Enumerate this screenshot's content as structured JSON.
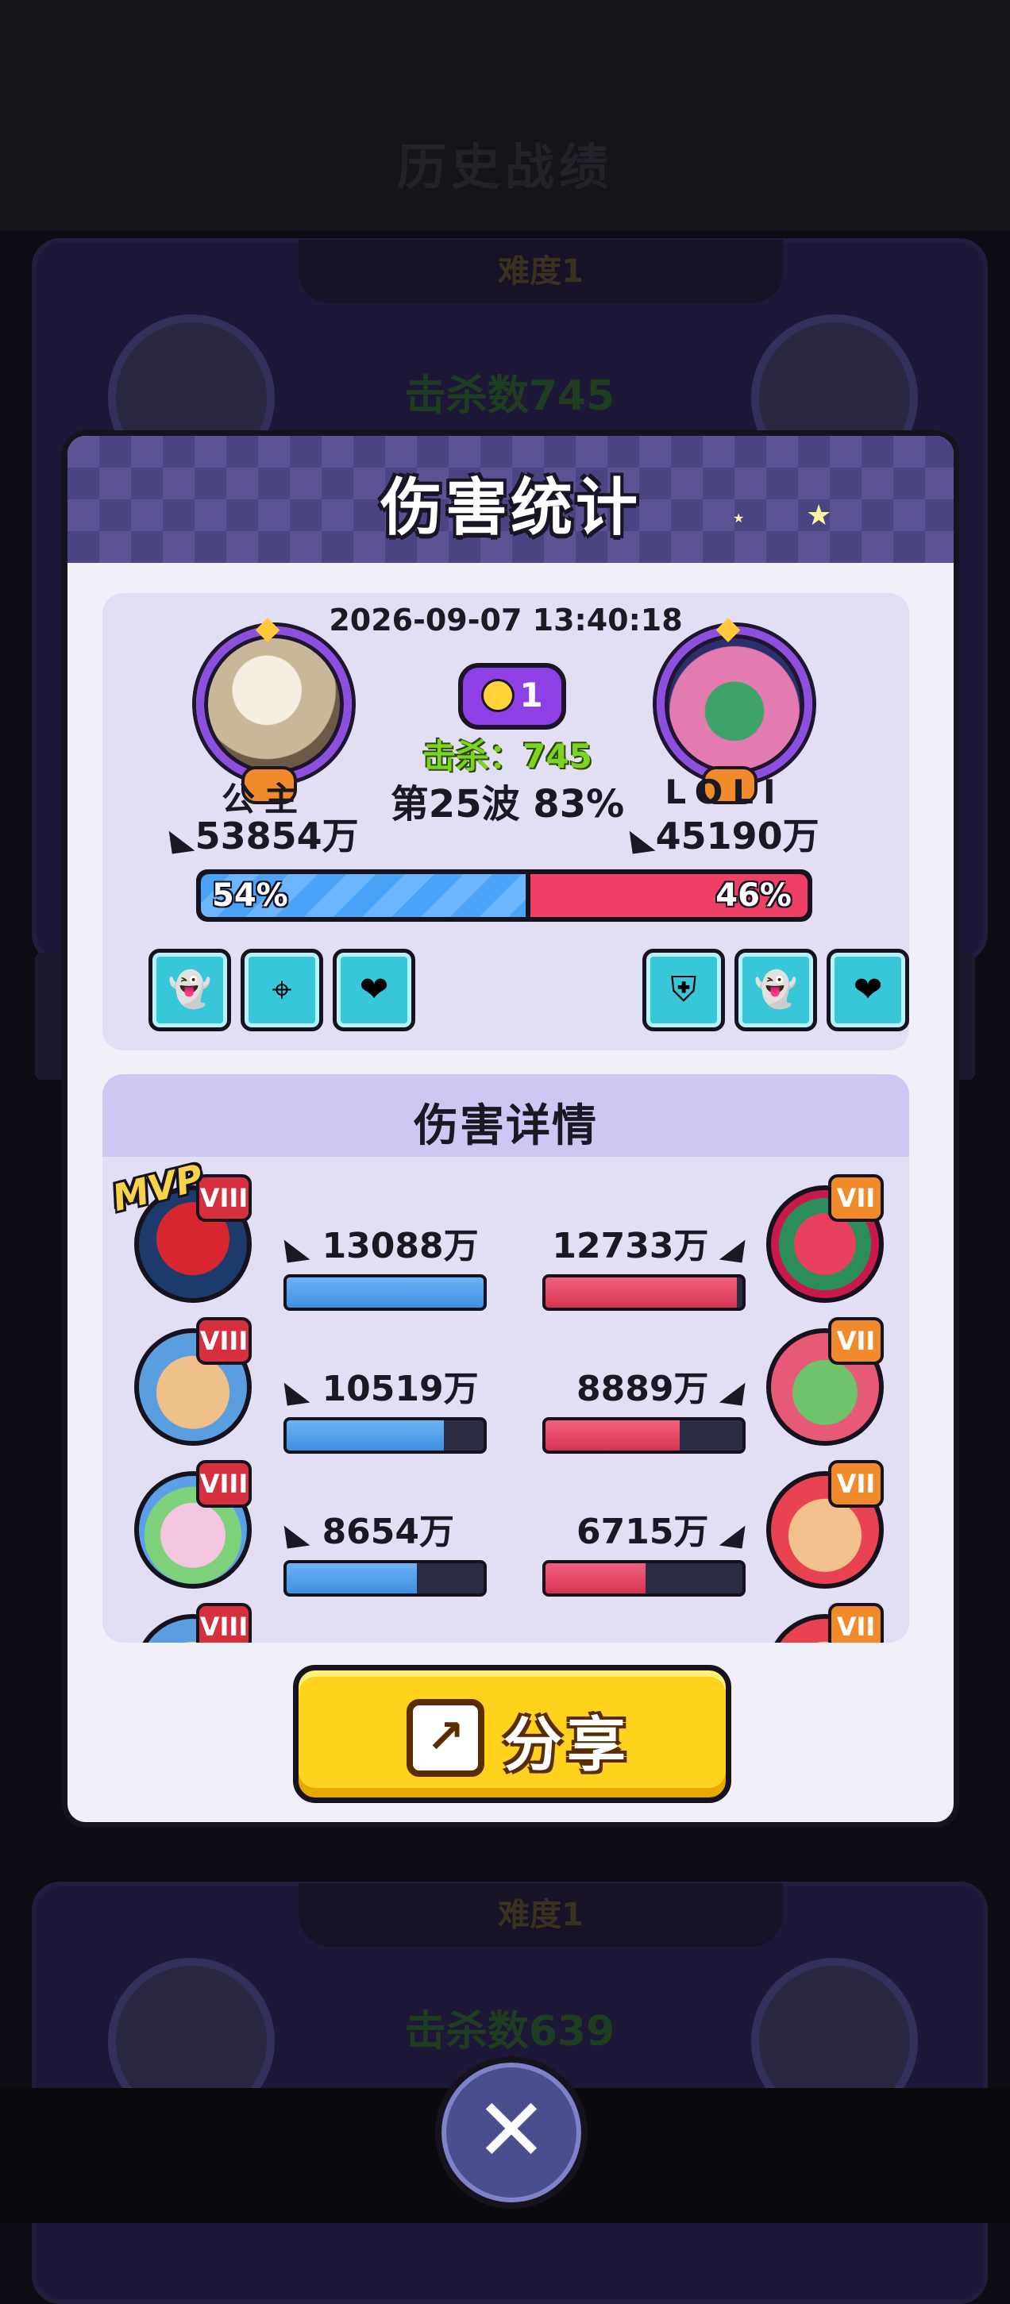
{
  "background": {
    "title": "历史战绩",
    "card1_tag": "难度1",
    "card1_kill": "击杀数745",
    "card2_tag": "难度1",
    "card2_kill": "击杀数639"
  },
  "modal": {
    "title": "伤害统计",
    "datetime": "2026-09-07 13:40:18",
    "difficulty": "1",
    "kill_label": "击杀：745",
    "wave_label": "第25波 83%",
    "left_player": {
      "name": "公主",
      "damage": "53854万",
      "percent_label": "54%",
      "percent_value": 0.54
    },
    "right_player": {
      "name": "LOLI",
      "damage": "45190万",
      "percent_label": "46%",
      "percent_value": 0.46
    },
    "left_skills": [
      "ghost-upgrade-icon",
      "crosshair-icon",
      "heart-plus-icon"
    ],
    "right_skills": [
      "shield-pig-icon",
      "ghost-upgrade-icon",
      "heart-plus-icon"
    ],
    "details_title": "伤害详情",
    "mvp_label": "MVP",
    "rows": [
      {
        "left_rank": "VIII",
        "left_damage": "13088万",
        "left_fill": 1.0,
        "right_rank": "VII",
        "right_damage": "12733万",
        "right_fill": 0.97
      },
      {
        "left_rank": "VIII",
        "left_damage": "10519万",
        "left_fill": 0.8,
        "right_rank": "VII",
        "right_damage": "8889万",
        "right_fill": 0.68
      },
      {
        "left_rank": "VIII",
        "left_damage": "8654万",
        "left_fill": 0.66,
        "right_rank": "VII",
        "right_damage": "6715万",
        "right_fill": 0.51
      },
      {
        "left_rank": "VIII",
        "left_damage": "",
        "left_fill": 0,
        "right_rank": "VII",
        "right_damage": "",
        "right_fill": 0
      }
    ],
    "share_label": "分享"
  },
  "colors": {
    "accent_purple": "#8f3fe6",
    "blue_team": "#4aa3f8",
    "red_team": "#ef3f66",
    "share_yellow": "#ffd21e",
    "kill_green": "#7ed321"
  }
}
